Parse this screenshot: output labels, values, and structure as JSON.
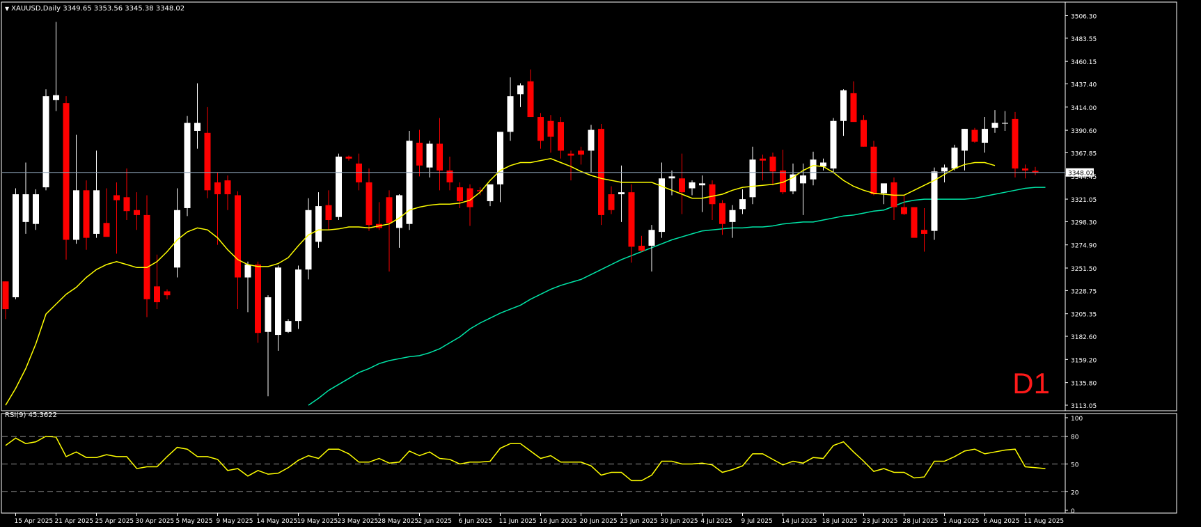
{
  "header": {
    "symbol_timeframe": "XAUUSD,Daily",
    "ohlc": "3349.65 3353.56 3345.38 3348.02"
  },
  "timeframe_label": "D1",
  "rsi_header": {
    "label": "RSI(9)",
    "value": "45.3622"
  },
  "colors": {
    "background": "#000000",
    "bull_candle": "#ffffff",
    "bear_candle": "#ff0000",
    "ma_fast": "#ffff00",
    "ma_slow": "#00e6a8",
    "rsi_line": "#ffff00",
    "current_price_line": "#8aa0b4",
    "axis_text": "#ffffff",
    "timeframe_label": "#ff1a1a"
  },
  "chart_data": [
    {
      "type": "candlestick",
      "symbol": "XAUUSD",
      "timeframe": "Daily",
      "current_price": 3348.02,
      "ylim": [
        3113.05,
        3515.0
      ],
      "y_ticks": [
        "3506.30",
        "3483.55",
        "3460.15",
        "3437.40",
        "3414.00",
        "3390.60",
        "3367.85",
        "3344.45",
        "3321.05",
        "3298.30",
        "3274.90",
        "3251.50",
        "3228.75",
        "3205.35",
        "3182.60",
        "3159.20",
        "3135.80",
        "3113.05"
      ],
      "x_ticks": [
        {
          "label": "15 Apr 2025",
          "index": 1
        },
        {
          "label": "21 Apr 2025",
          "index": 5
        },
        {
          "label": "25 Apr 2025",
          "index": 9
        },
        {
          "label": "30 Apr 2025",
          "index": 13
        },
        {
          "label": "5 May 2025",
          "index": 17
        },
        {
          "label": "9 May 2025",
          "index": 21
        },
        {
          "label": "14 May 2025",
          "index": 25
        },
        {
          "label": "19 May 2025",
          "index": 29
        },
        {
          "label": "23 May 2025",
          "index": 33
        },
        {
          "label": "28 May 2025",
          "index": 37
        },
        {
          "label": "2 Jun 2025",
          "index": 41
        },
        {
          "label": "6 Jun 2025",
          "index": 45
        },
        {
          "label": "11 Jun 2025",
          "index": 49
        },
        {
          "label": "16 Jun 2025",
          "index": 53
        },
        {
          "label": "20 Jun 2025",
          "index": 57
        },
        {
          "label": "25 Jun 2025",
          "index": 61
        },
        {
          "label": "30 Jun 2025",
          "index": 65
        },
        {
          "label": "4 Jul 2025",
          "index": 69
        },
        {
          "label": "9 Jul 2025",
          "index": 73
        },
        {
          "label": "14 Jul 2025",
          "index": 77
        },
        {
          "label": "18 Jul 2025",
          "index": 81
        },
        {
          "label": "23 Jul 2025",
          "index": 85
        },
        {
          "label": "28 Jul 2025",
          "index": 89
        },
        {
          "label": "1 Aug 2025",
          "index": 93
        },
        {
          "label": "6 Aug 2025",
          "index": 97
        },
        {
          "label": "11 Aug 2025",
          "index": 101
        }
      ],
      "candles": [
        {
          "o": 3238,
          "h": 3238,
          "l": 3200,
          "c": 3210
        },
        {
          "o": 3222,
          "h": 3332,
          "l": 3220,
          "c": 3326
        },
        {
          "o": 3298,
          "h": 3358,
          "l": 3286,
          "c": 3326
        },
        {
          "o": 3296,
          "h": 3331,
          "l": 3290,
          "c": 3326
        },
        {
          "o": 3333,
          "h": 3432,
          "l": 3330,
          "c": 3425
        },
        {
          "o": 3421,
          "h": 3500,
          "l": 3410,
          "c": 3426
        },
        {
          "o": 3418,
          "h": 3425,
          "l": 3260,
          "c": 3280
        },
        {
          "o": 3280,
          "h": 3386,
          "l": 3276,
          "c": 3330
        },
        {
          "o": 3330,
          "h": 3340,
          "l": 3270,
          "c": 3282
        },
        {
          "o": 3286,
          "h": 3370,
          "l": 3282,
          "c": 3330
        },
        {
          "o": 3297,
          "h": 3332,
          "l": 3285,
          "c": 3283
        },
        {
          "o": 3325,
          "h": 3338,
          "l": 3266,
          "c": 3320
        },
        {
          "o": 3323,
          "h": 3352,
          "l": 3300,
          "c": 3309
        },
        {
          "o": 3310,
          "h": 3328,
          "l": 3290,
          "c": 3305
        },
        {
          "o": 3305,
          "h": 3325,
          "l": 3202,
          "c": 3220
        },
        {
          "o": 3233,
          "h": 3265,
          "l": 3210,
          "c": 3217
        },
        {
          "o": 3228,
          "h": 3230,
          "l": 3220,
          "c": 3224
        },
        {
          "o": 3252,
          "h": 3332,
          "l": 3242,
          "c": 3310
        },
        {
          "o": 3312,
          "h": 3405,
          "l": 3304,
          "c": 3398
        },
        {
          "o": 3390,
          "h": 3438,
          "l": 3372,
          "c": 3398
        },
        {
          "o": 3388,
          "h": 3414,
          "l": 3322,
          "c": 3330
        },
        {
          "o": 3338,
          "h": 3348,
          "l": 3275,
          "c": 3326
        },
        {
          "o": 3340,
          "h": 3345,
          "l": 3310,
          "c": 3326
        },
        {
          "o": 3325,
          "h": 3329,
          "l": 3210,
          "c": 3242
        },
        {
          "o": 3242,
          "h": 3258,
          "l": 3207,
          "c": 3255
        },
        {
          "o": 3255,
          "h": 3258,
          "l": 3176,
          "c": 3186
        },
        {
          "o": 3187,
          "h": 3224,
          "l": 3122,
          "c": 3222
        },
        {
          "o": 3184,
          "h": 3254,
          "l": 3168,
          "c": 3252
        },
        {
          "o": 3187,
          "h": 3200,
          "l": 3186,
          "c": 3198
        },
        {
          "o": 3198,
          "h": 3254,
          "l": 3190,
          "c": 3250
        },
        {
          "o": 3250,
          "h": 3322,
          "l": 3240,
          "c": 3310
        },
        {
          "o": 3278,
          "h": 3328,
          "l": 3272,
          "c": 3314
        },
        {
          "o": 3315,
          "h": 3330,
          "l": 3290,
          "c": 3300
        },
        {
          "o": 3303,
          "h": 3367,
          "l": 3300,
          "c": 3364
        },
        {
          "o": 3364,
          "h": 3365,
          "l": 3360,
          "c": 3362
        },
        {
          "o": 3357,
          "h": 3367,
          "l": 3330,
          "c": 3338
        },
        {
          "o": 3338,
          "h": 3352,
          "l": 3289,
          "c": 3295
        },
        {
          "o": 3296,
          "h": 3318,
          "l": 3290,
          "c": 3292
        },
        {
          "o": 3323,
          "h": 3330,
          "l": 3248,
          "c": 3297
        },
        {
          "o": 3292,
          "h": 3326,
          "l": 3272,
          "c": 3325
        },
        {
          "o": 3296,
          "h": 3390,
          "l": 3290,
          "c": 3380
        },
        {
          "o": 3378,
          "h": 3391,
          "l": 3344,
          "c": 3355
        },
        {
          "o": 3353,
          "h": 3380,
          "l": 3343,
          "c": 3377
        },
        {
          "o": 3377,
          "h": 3403,
          "l": 3330,
          "c": 3350
        },
        {
          "o": 3350,
          "h": 3364,
          "l": 3330,
          "c": 3338
        },
        {
          "o": 3333,
          "h": 3338,
          "l": 3312,
          "c": 3319
        },
        {
          "o": 3332,
          "h": 3336,
          "l": 3294,
          "c": 3313
        },
        {
          "o": 3330,
          "h": 3333,
          "l": 3325,
          "c": 3329
        },
        {
          "o": 3319,
          "h": 3333,
          "l": 3314,
          "c": 3336
        },
        {
          "o": 3336,
          "h": 3350,
          "l": 3318,
          "c": 3389
        },
        {
          "o": 3389,
          "h": 3444,
          "l": 3380,
          "c": 3425
        },
        {
          "o": 3427,
          "h": 3438,
          "l": 3414,
          "c": 3436
        },
        {
          "o": 3440,
          "h": 3452,
          "l": 3407,
          "c": 3404
        },
        {
          "o": 3404,
          "h": 3408,
          "l": 3372,
          "c": 3380
        },
        {
          "o": 3400,
          "h": 3406,
          "l": 3368,
          "c": 3384
        },
        {
          "o": 3399,
          "h": 3404,
          "l": 3362,
          "c": 3370
        },
        {
          "o": 3367,
          "h": 3370,
          "l": 3340,
          "c": 3365
        },
        {
          "o": 3370,
          "h": 3374,
          "l": 3356,
          "c": 3366
        },
        {
          "o": 3370,
          "h": 3396,
          "l": 3348,
          "c": 3391
        },
        {
          "o": 3392,
          "h": 3397,
          "l": 3295,
          "c": 3305
        },
        {
          "o": 3326,
          "h": 3334,
          "l": 3306,
          "c": 3310
        },
        {
          "o": 3326,
          "h": 3355,
          "l": 3298,
          "c": 3328
        },
        {
          "o": 3328,
          "h": 3336,
          "l": 3257,
          "c": 3273
        },
        {
          "o": 3274,
          "h": 3284,
          "l": 3268,
          "c": 3269
        },
        {
          "o": 3274,
          "h": 3295,
          "l": 3248,
          "c": 3290
        },
        {
          "o": 3288,
          "h": 3358,
          "l": 3282,
          "c": 3342
        },
        {
          "o": 3342,
          "h": 3350,
          "l": 3325,
          "c": 3344
        },
        {
          "o": 3342,
          "h": 3367,
          "l": 3306,
          "c": 3328
        },
        {
          "o": 3332,
          "h": 3340,
          "l": 3325,
          "c": 3338
        },
        {
          "o": 3335,
          "h": 3345,
          "l": 3308,
          "c": 3337
        },
        {
          "o": 3336,
          "h": 3340,
          "l": 3300,
          "c": 3316
        },
        {
          "o": 3317,
          "h": 3320,
          "l": 3285,
          "c": 3296
        },
        {
          "o": 3298,
          "h": 3315,
          "l": 3282,
          "c": 3310
        },
        {
          "o": 3311,
          "h": 3331,
          "l": 3306,
          "c": 3321
        },
        {
          "o": 3323,
          "h": 3374,
          "l": 3316,
          "c": 3361
        },
        {
          "o": 3362,
          "h": 3366,
          "l": 3340,
          "c": 3360
        },
        {
          "o": 3364,
          "h": 3368,
          "l": 3335,
          "c": 3349
        },
        {
          "o": 3350,
          "h": 3371,
          "l": 3326,
          "c": 3328
        },
        {
          "o": 3329,
          "h": 3357,
          "l": 3326,
          "c": 3346
        },
        {
          "o": 3337,
          "h": 3357,
          "l": 3305,
          "c": 3345
        },
        {
          "o": 3341,
          "h": 3369,
          "l": 3335,
          "c": 3361
        },
        {
          "o": 3354,
          "h": 3362,
          "l": 3350,
          "c": 3358
        },
        {
          "o": 3352,
          "h": 3403,
          "l": 3348,
          "c": 3400
        },
        {
          "o": 3400,
          "h": 3432,
          "l": 3385,
          "c": 3431
        },
        {
          "o": 3428,
          "h": 3440,
          "l": 3403,
          "c": 3399
        },
        {
          "o": 3401,
          "h": 3406,
          "l": 3374,
          "c": 3374
        },
        {
          "o": 3374,
          "h": 3380,
          "l": 3325,
          "c": 3326
        },
        {
          "o": 3327,
          "h": 3335,
          "l": 3316,
          "c": 3337
        },
        {
          "o": 3338,
          "h": 3343,
          "l": 3300,
          "c": 3313
        },
        {
          "o": 3313,
          "h": 3325,
          "l": 3305,
          "c": 3306
        },
        {
          "o": 3313,
          "h": 3313,
          "l": 3288,
          "c": 3282
        },
        {
          "o": 3290,
          "h": 3312,
          "l": 3268,
          "c": 3286
        },
        {
          "o": 3289,
          "h": 3353,
          "l": 3280,
          "c": 3349
        },
        {
          "o": 3349,
          "h": 3356,
          "l": 3338,
          "c": 3353
        },
        {
          "o": 3352,
          "h": 3376,
          "l": 3350,
          "c": 3373
        },
        {
          "o": 3370,
          "h": 3392,
          "l": 3350,
          "c": 3392
        },
        {
          "o": 3391,
          "h": 3393,
          "l": 3378,
          "c": 3379
        },
        {
          "o": 3378,
          "h": 3404,
          "l": 3368,
          "c": 3392
        },
        {
          "o": 3393,
          "h": 3411,
          "l": 3388,
          "c": 3398
        },
        {
          "o": 3398,
          "h": 3410,
          "l": 3390,
          "c": 3398
        },
        {
          "o": 3402,
          "h": 3409,
          "l": 3343,
          "c": 3352
        },
        {
          "o": 3352,
          "h": 3356,
          "l": 3342,
          "c": 3350
        },
        {
          "o": 3349.65,
          "h": 3353.56,
          "l": 3345.38,
          "c": 3348.02
        }
      ],
      "ma_fast": [
        3113,
        3130,
        3150,
        3175,
        3205,
        3215,
        3225,
        3232,
        3242,
        3250,
        3255,
        3258,
        3255,
        3252,
        3252,
        3258,
        3268,
        3280,
        3288,
        3292,
        3290,
        3282,
        3270,
        3260,
        3255,
        3253,
        3253,
        3256,
        3262,
        3274,
        3285,
        3290,
        3290,
        3291,
        3293,
        3293,
        3292,
        3294,
        3296,
        3302,
        3310,
        3313,
        3315,
        3316,
        3316,
        3317,
        3320,
        3328,
        3340,
        3350,
        3355,
        3358,
        3358,
        3360,
        3362,
        3358,
        3354,
        3349,
        3345,
        3342,
        3340,
        3338,
        3338,
        3338,
        3338,
        3334,
        3330,
        3326,
        3322,
        3322,
        3324,
        3326,
        3330,
        3333,
        3334,
        3335,
        3336,
        3338,
        3343,
        3350,
        3355,
        3354,
        3348,
        3340,
        3334,
        3330,
        3327,
        3326,
        3325,
        3325,
        3330,
        3335,
        3340,
        3346,
        3352,
        3356,
        3358,
        3358,
        3355
      ],
      "ma_slow": [
        3113,
        3120,
        3128,
        3134,
        3140,
        3146,
        3150,
        3155,
        3158,
        3160,
        3162,
        3163,
        3166,
        3170,
        3176,
        3182,
        3190,
        3196,
        3201,
        3206,
        3210,
        3214,
        3220,
        3225,
        3230,
        3234,
        3237,
        3240,
        3245,
        3250,
        3255,
        3260,
        3264,
        3268,
        3272,
        3276,
        3280,
        3283,
        3286,
        3289,
        3290,
        3291,
        3292,
        3292,
        3293,
        3293,
        3294,
        3296,
        3297,
        3298,
        3298,
        3300,
        3302,
        3304,
        3305,
        3307,
        3309,
        3310,
        3314,
        3318,
        3320,
        3321,
        3321,
        3321,
        3321,
        3321,
        3322,
        3324,
        3326,
        3328,
        3330,
        3332,
        3333,
        3333
      ],
      "ma_slow_start_index": 30
    },
    {
      "type": "line",
      "name": "RSI(9)",
      "ylim": [
        0,
        100
      ],
      "y_ticks": [
        "100",
        "80",
        "50",
        "20",
        "0"
      ],
      "levels": [
        80,
        50,
        20
      ],
      "values": [
        70,
        78,
        72,
        74,
        80,
        79,
        58,
        63,
        57,
        57,
        60,
        58,
        58,
        45,
        47,
        47,
        58,
        68,
        66,
        58,
        58,
        55,
        43,
        45,
        37,
        43,
        39,
        40,
        46,
        54,
        59,
        56,
        66,
        66,
        61,
        52,
        52,
        56,
        51,
        52,
        64,
        59,
        63,
        56,
        55,
        50,
        52,
        52,
        53,
        67,
        72,
        72,
        64,
        56,
        59,
        52,
        52,
        52,
        48,
        38,
        41,
        41,
        32,
        32,
        38,
        53,
        53,
        50,
        50,
        51,
        49,
        41,
        44,
        48,
        61,
        61,
        55,
        49,
        53,
        51,
        57,
        56,
        70,
        74,
        63,
        53,
        42,
        45,
        41,
        41,
        35,
        36,
        53,
        53,
        58,
        64,
        66,
        61,
        63,
        65,
        66,
        47,
        46,
        45
      ]
    }
  ]
}
